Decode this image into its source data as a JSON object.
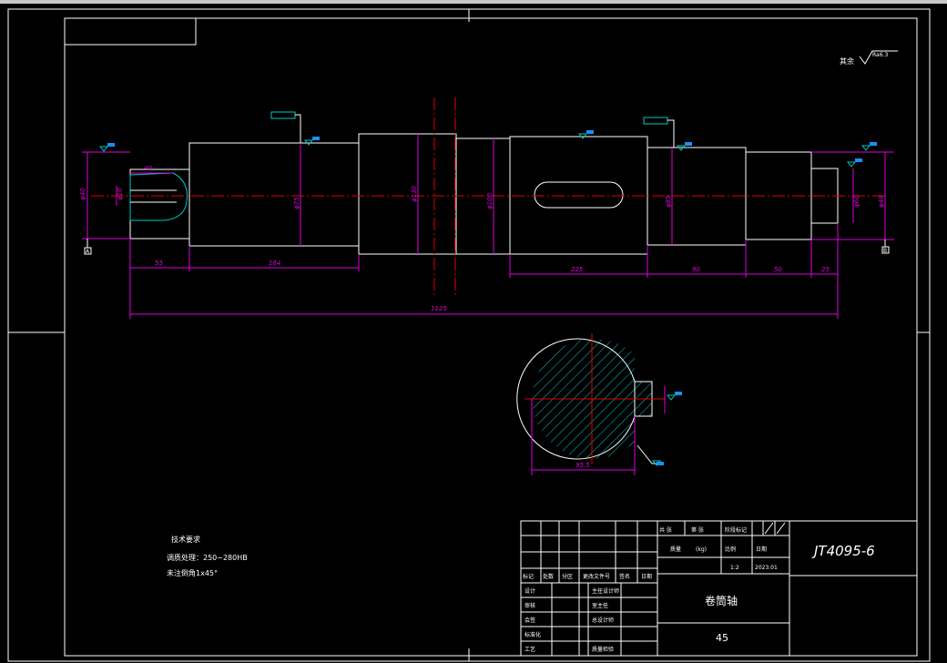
{
  "dimensions": {
    "d_55": "55",
    "d_164": "164",
    "d_225": "225",
    "d_90": "90",
    "d_50": "50",
    "d_25": "25",
    "d_1125": "1125",
    "d_40": "40",
    "dia_left": "φ40",
    "dia_key": "φ10",
    "dia_main": "φ75",
    "dia_collar": "φ130",
    "dia_drum": "φ100",
    "dia_seat": "φ85",
    "dia_right1": "φ60",
    "dia_right2": "φ48",
    "section_depth": "95.5"
  },
  "roughness": {
    "label": "其余",
    "value": "Ra6.3"
  },
  "tech_requirements": {
    "title": "技术要求",
    "line1": "调质处理：250~280HB",
    "line2": "未注倒角1x45°"
  },
  "title_block": {
    "drawing_no": "JT4095-6",
    "part_name": "卷筒轴",
    "material": "45",
    "scale_label": "比例",
    "scale_value": "1:2",
    "date_label": "日期",
    "date_value": "2023.01",
    "mass_label": "质量",
    "mass_unit": "(kg)",
    "sheets_label": "共 张",
    "sheet_label": "第 张",
    "stage_label": "阶段标记",
    "rev_headers": [
      "标记",
      "处数",
      "分区",
      "更改文件号",
      "签名",
      "日期"
    ],
    "sig_left": [
      "设计",
      "审核",
      "会签",
      "标准化",
      "工艺"
    ],
    "sig_right": [
      "主任设计师",
      "室主任",
      "总设计师",
      "",
      "质量检验"
    ]
  },
  "datum": {
    "left": "A",
    "right": "B"
  }
}
